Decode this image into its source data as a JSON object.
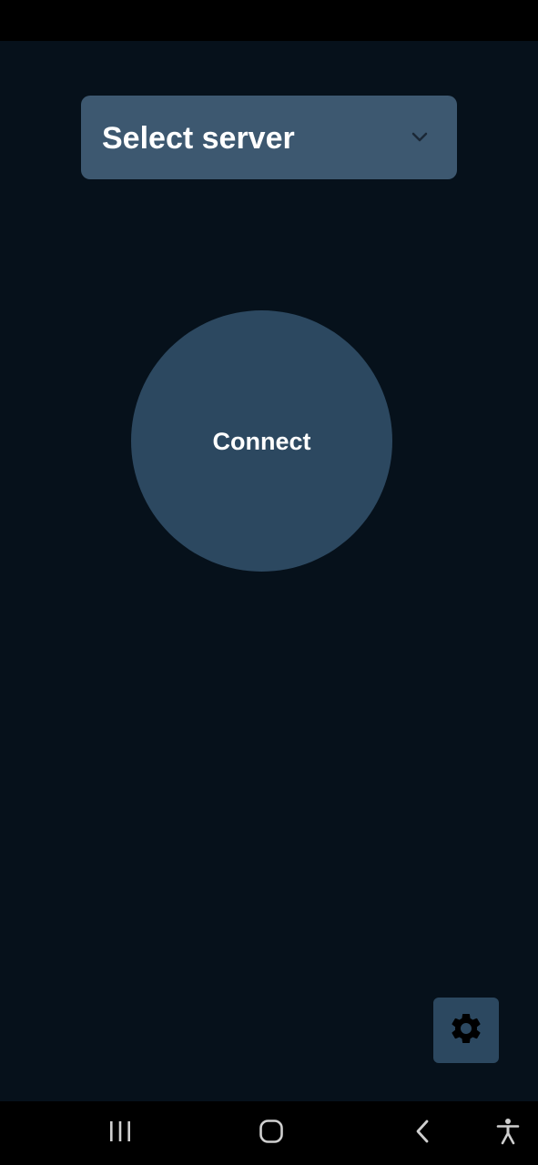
{
  "server_select": {
    "label": "Select server",
    "icon": "chevron-down-icon"
  },
  "connect_button": {
    "label": "Connect"
  },
  "settings_button": {
    "icon": "gear-icon"
  },
  "nav_bar": {
    "items": [
      {
        "icon": "recent-apps-icon"
      },
      {
        "icon": "home-icon"
      },
      {
        "icon": "back-icon"
      },
      {
        "icon": "accessibility-icon"
      }
    ]
  },
  "colors": {
    "background": "#06111b",
    "select_background": "#3d5870",
    "button_background": "#2c4860",
    "text": "#ffffff"
  }
}
